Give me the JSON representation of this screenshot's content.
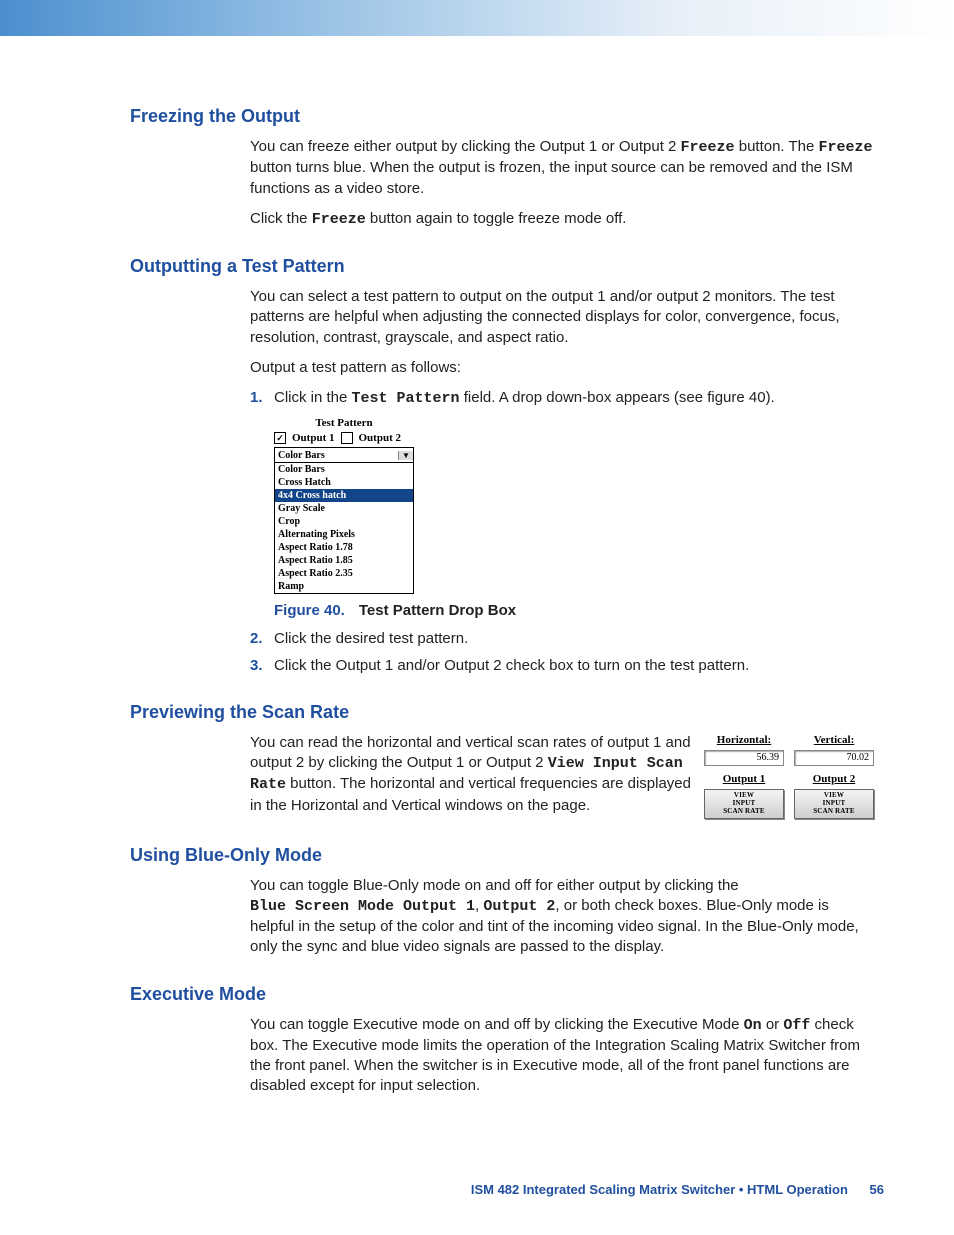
{
  "sections": {
    "freezing": {
      "heading": "Freezing the Output",
      "p1a": "You can freeze either output by clicking the Output 1 or Output 2 ",
      "p1_mono": "Freeze",
      "p1b": " button.  The ",
      "p1_mono2": "Freeze",
      "p1c": " button turns blue.  When the output is frozen, the input source can be removed and the ISM functions as a video store.",
      "p2a": "Click the ",
      "p2_mono": "Freeze",
      "p2b": " button again to toggle freeze mode off."
    },
    "test_pattern": {
      "heading": "Outputting a Test Pattern",
      "p1": "You can select a test pattern to output on the output 1 and/or output 2 monitors.  The test patterns are helpful when adjusting the connected displays for color, convergence, focus, resolution, contrast, grayscale, and aspect ratio.",
      "p2": "Output a test pattern as follows:",
      "step1a": "Click in the ",
      "step1_mono": "Test Pattern",
      "step1b": " field.  A drop down-box appears (see figure 40).",
      "step2": "Click the desired test pattern.",
      "step3": "Click the Output 1 and/or Output 2 check box to turn on the test pattern.",
      "fig_num": "Figure 40.",
      "fig_title": "Test Pattern Drop Box",
      "dropbox": {
        "title": "Test Pattern",
        "cb1_label": "Output 1",
        "cb1_checked": "✓",
        "cb2_label": "Output 2",
        "selected": "Color Bars",
        "options": [
          "Color Bars",
          "Cross Hatch",
          "4x4 Cross hatch",
          "Gray Scale",
          "Crop",
          "Alternating Pixels",
          "Aspect Ratio 1.78",
          "Aspect Ratio 1.85",
          "Aspect Ratio 2.35",
          "Ramp"
        ],
        "highlight_index": 2
      }
    },
    "scan_rate": {
      "heading": "Previewing the Scan Rate",
      "p1a": "You can read the horizontal and vertical scan rates of output 1 and output 2 by clicking the Output 1 or Output 2 ",
      "p1_mono": "View Input Scan Rate",
      "p1b": " button.  The  horizontal and vertical frequencies are displayed in the Horizontal and Vertical windows on the page.",
      "panel": {
        "h_label": "Horizontal:",
        "v_label": "Vertical:",
        "h_value": "56.39",
        "v_value": "70.02",
        "out1": "Output 1",
        "out2": "Output 2",
        "btn": "VIEW\nINPUT\nSCAN RATE"
      }
    },
    "blue_only": {
      "heading": "Using Blue-Only Mode",
      "p1a": "You can toggle Blue-Only mode on and off for either output by clicking the ",
      "p1_mono1": "Blue Screen Mode Output 1",
      "p1_sep": ", ",
      "p1_mono2": "Output 2",
      "p1b": ", or both check boxes.  Blue-Only mode is helpful in the setup of the color and tint of the incoming video signal.  In the Blue-Only mode, only the sync and blue video signals are passed to the display."
    },
    "exec": {
      "heading": "Executive Mode",
      "p1a": "You can toggle Executive mode on and off by clicking the Executive Mode ",
      "p1_mono1": "On",
      "p1_mid": " or ",
      "p1_mono2": "Off",
      "p1b": " check box.  The Executive mode limits the operation of the Integration Scaling Matrix Switcher from the front panel.  When the switcher is in Executive mode, all of the front panel functions are disabled except for input selection."
    }
  },
  "footer": {
    "text": "ISM 482 Integrated Scaling Matrix Switcher • HTML Operation",
    "page": "56"
  }
}
